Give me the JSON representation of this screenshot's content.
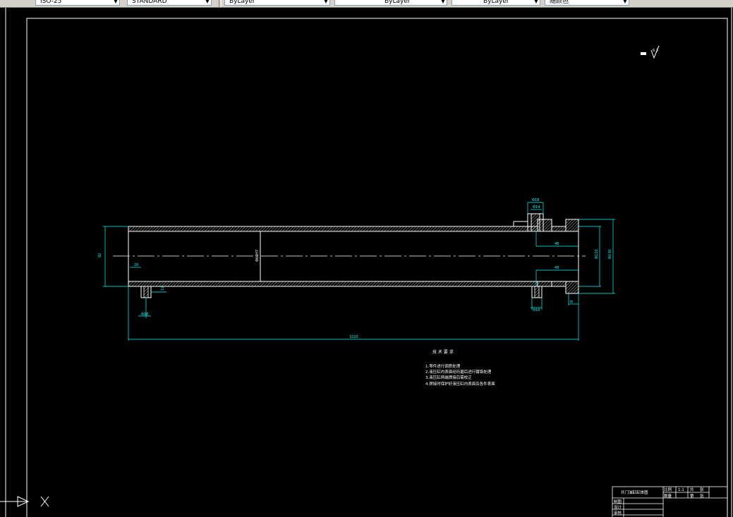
{
  "toolbar": {
    "combos": [
      {
        "text": "ISO-25"
      },
      {
        "text": "STANDARD"
      },
      {
        "text": "ByLayer"
      },
      {
        "text": "ByLayer"
      },
      {
        "text": "ByLayer"
      },
      {
        "text": "随颜色"
      }
    ]
  },
  "drawing": {
    "colors": {
      "background": "#000000",
      "border": "#ffffff",
      "dimension": "#00ffff"
    },
    "dimensions": {
      "d1": "20",
      "d2": "14",
      "d3": "8",
      "left_dia": "92",
      "total_len": "1020",
      "left_height": "12",
      "hole_left": "Φ18",
      "inner_dia": "Φ60H7",
      "right_top1": "Φ18",
      "right_top2": "Φ14",
      "right_mid1": "48",
      "right_mid2": "48",
      "right_bottom": "Φ18",
      "right_small": "8",
      "right_dia1": "Φ110",
      "right_dia2": "Φ130"
    },
    "roughness_symbol": "6.3",
    "tech_title": "技 术 要 求",
    "tech_notes": [
      "1.零件进行调质处理",
      "2.液压缸内表面经珩磨后进行镀铬处理",
      "3.液压缸两端焊接后需校正",
      "4.焊接时保护好液压缸内表面及各件表面"
    ],
    "title_block": {
      "title": "共门油缸缸体图",
      "scale_label": "比例",
      "scale_value": "1:1",
      "sheet_label": "共",
      "sheet_unit": "张",
      "qty_label": "数量",
      "page_label": "第",
      "page_unit": "张",
      "rows": [
        "制图",
        "设计",
        "审核"
      ]
    }
  }
}
